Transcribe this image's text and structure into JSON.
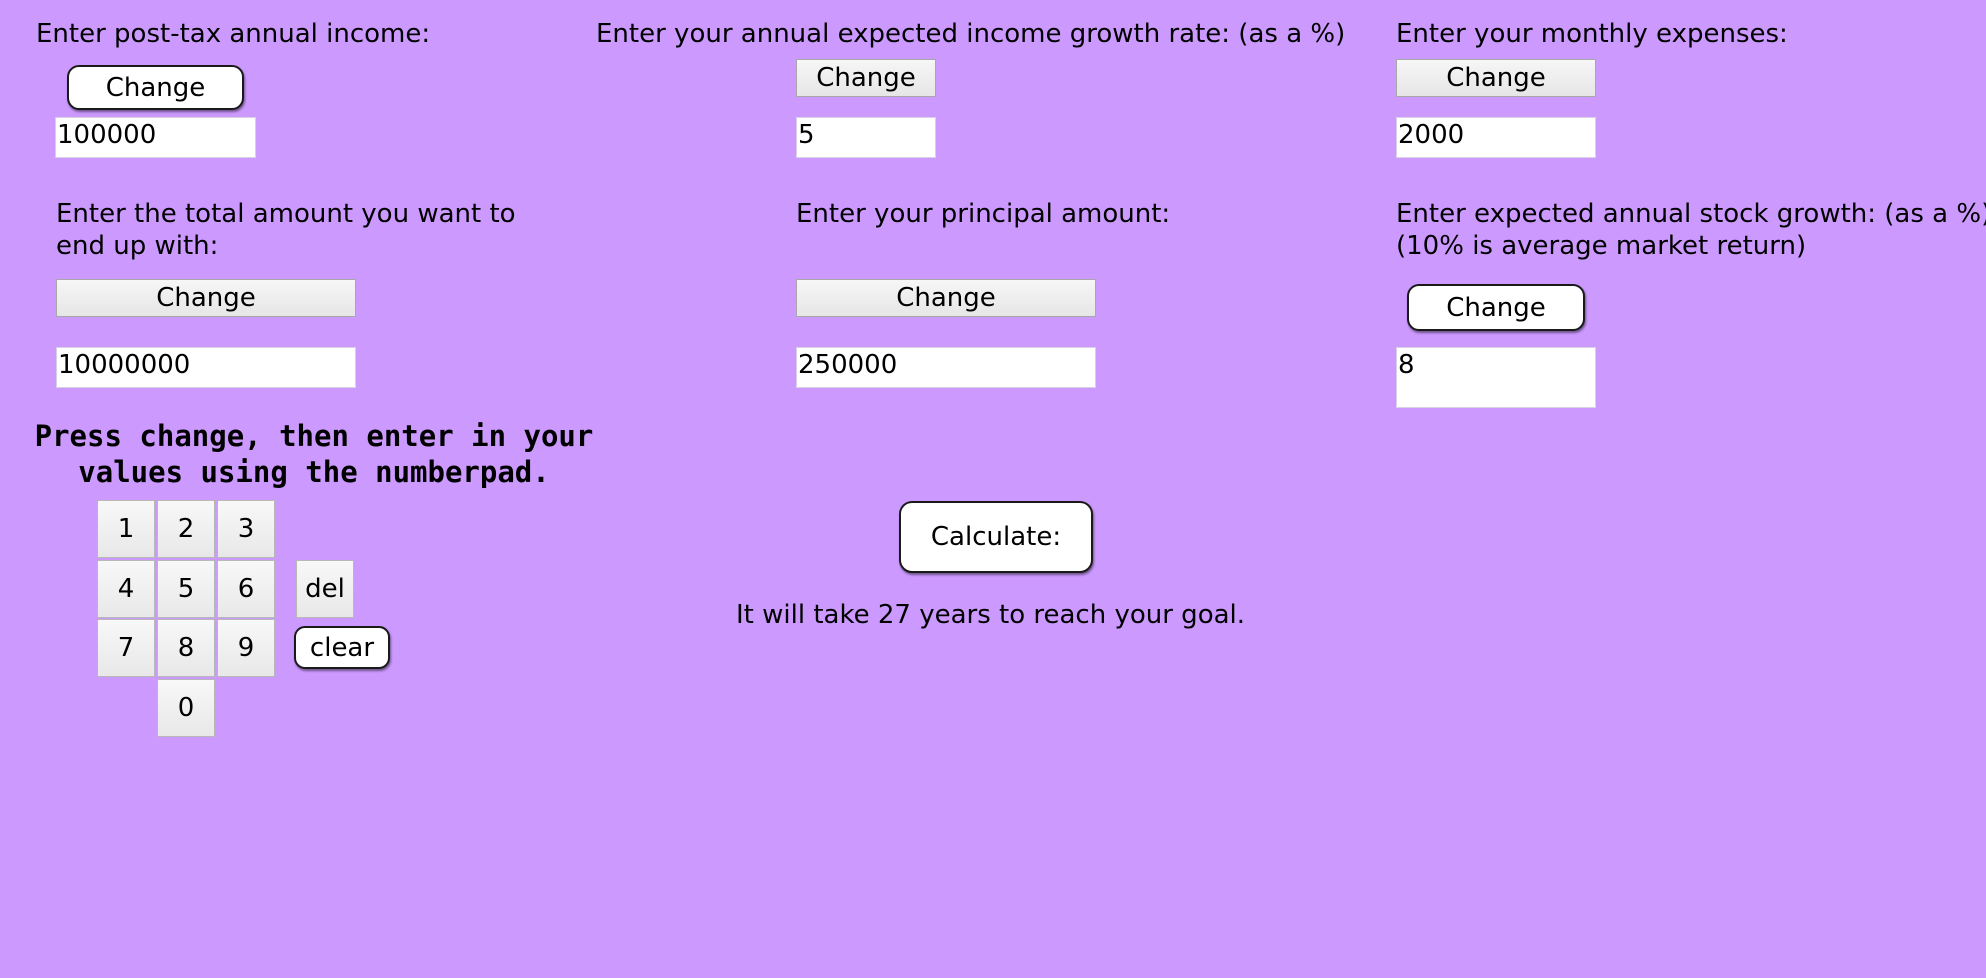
{
  "income": {
    "label": "Enter post-tax annual income:",
    "button_label": "Change",
    "value": "100000"
  },
  "income_growth": {
    "label": "Enter your annual expected income growth rate: (as a %)",
    "button_label": "Change",
    "value": "5"
  },
  "expenses": {
    "label": "Enter your monthly expenses:",
    "button_label": "Change",
    "value": "2000"
  },
  "target": {
    "label_line1": "Enter the total amount you want to",
    "label_line2": "end up with:",
    "button_label": "Change",
    "value": "10000000"
  },
  "principal": {
    "label": "Enter your principal amount:",
    "button_label": "Change",
    "value": "250000"
  },
  "stock_growth": {
    "label_line1": "Enter expected annual stock growth: (as a %)",
    "label_line2": "(10% is average market return)",
    "button_label": "Change",
    "value": "8"
  },
  "instructions": "Press change, then enter in your\nvalues using the numberpad.",
  "numpad": {
    "keys": [
      "1",
      "2",
      "3",
      "4",
      "5",
      "6",
      "7",
      "8",
      "9",
      "0"
    ],
    "del_label": "del",
    "clear_label": "clear"
  },
  "calculate_label": "Calculate:",
  "result_text": "It will take 27 years to reach your goal."
}
